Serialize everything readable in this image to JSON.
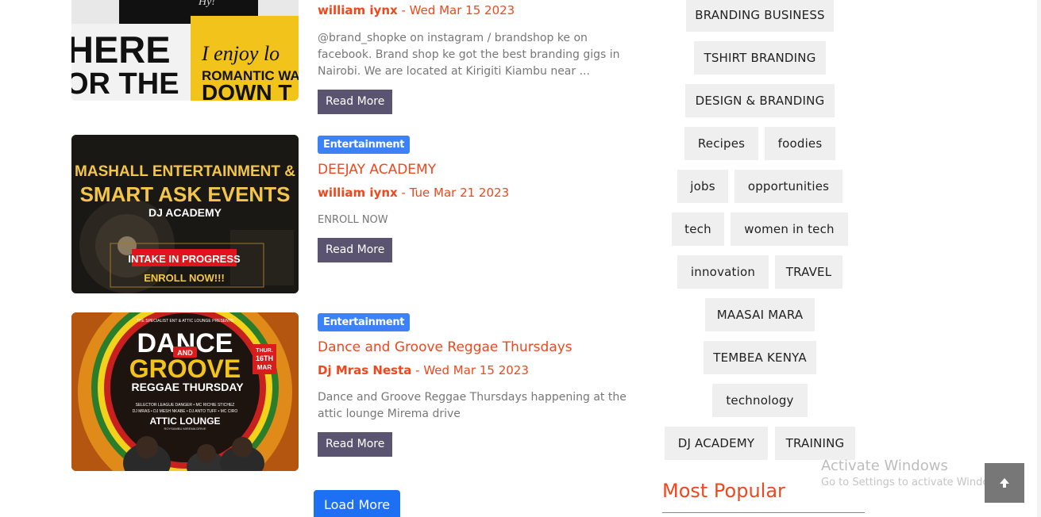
{
  "posts": [
    {
      "author": "william iynx",
      "sep": " - ",
      "date": "Wed Mar 15 2023",
      "excerpt": "@brand_shopke on instagram / brandshop ke on facebook. Brand shop ke got the best branding gigs in Nairobi. We are located at Kirigiti Kiambu near ...",
      "read_more": "Read More",
      "image": {
        "lines": [
          "HERE",
          "OR THE"
        ],
        "slogan": [
          "I enjoy lo",
          "ROMANTIC WA",
          "DOWN T"
        ],
        "top_text": "Hy!"
      }
    },
    {
      "category": "Entertainment",
      "title": "DEEJAY ACADEMY",
      "author": "william iynx",
      "sep": " - ",
      "date": "Tue Mar 21 2023",
      "excerpt": "ENROLL NOW",
      "read_more": "Read More",
      "image": {
        "line1": "MASHALL ENTERTAINMENT &",
        "line2": "SMART ASK EVENTS",
        "line3": "DJ ACADEMY",
        "box1": "INTAKE IN PROGRESS",
        "box2": "ENROLL NOW!!!"
      }
    },
    {
      "category": "Entertainment",
      "title": "Dance and Groove Reggae Thursdays",
      "author": "Dj Mras Nesta",
      "sep": " - ",
      "date": "Wed Mar 15 2023",
      "excerpt": "Dance and Groove Reggae Thursdays happening at the attic lounge Mirema drive",
      "read_more": "Read More",
      "image": {
        "presents": "THE SPECIALIST ENT & ATTIC LOUNGE PRESENTS",
        "dance": "DANCE",
        "and": "AND",
        "groove": "GROOVE",
        "reggae": "REGGAE THURSDAY",
        "date_badge": [
          "THUR.",
          "16TH",
          "MAR"
        ],
        "lineup1": "SELECTOR LEAGUE DANGER • MC RICHIE STICHEZ",
        "lineup2": "DJ MRAS • DJ MESH NKABE • DJ ANTO TUFF • MC CIRO",
        "venue": "ATTIC LOUNGE",
        "venue_sub": "ROYSAMBU MIREMA DRIVE"
      }
    }
  ],
  "load_more": "Load More",
  "tags": [
    "BRANDING BUSINESS",
    "TSHIRT BRANDING",
    "DESIGN & BRANDING",
    "Recipes",
    "foodies",
    "jobs",
    "opportunities",
    "tech",
    "women in tech",
    "innovation",
    "TRAVEL",
    "MAASAI MARA",
    "TEMBEA KENYA",
    "technology",
    "DJ ACADEMY",
    "TRAINING"
  ],
  "sidebar": {
    "most_popular": "Most Popular"
  },
  "watermark": {
    "line1": "Activate Windows",
    "line2": "Go to Settings to activate Windows."
  },
  "back_to_top": {
    "icon": "arrow-up-icon"
  },
  "colors": {
    "accent": "#f0471c",
    "badge": "#3b82f6",
    "read_more_bg": "#5a5470",
    "load_more_bg": "#1d6ff3",
    "tag_bg": "#efefef"
  }
}
